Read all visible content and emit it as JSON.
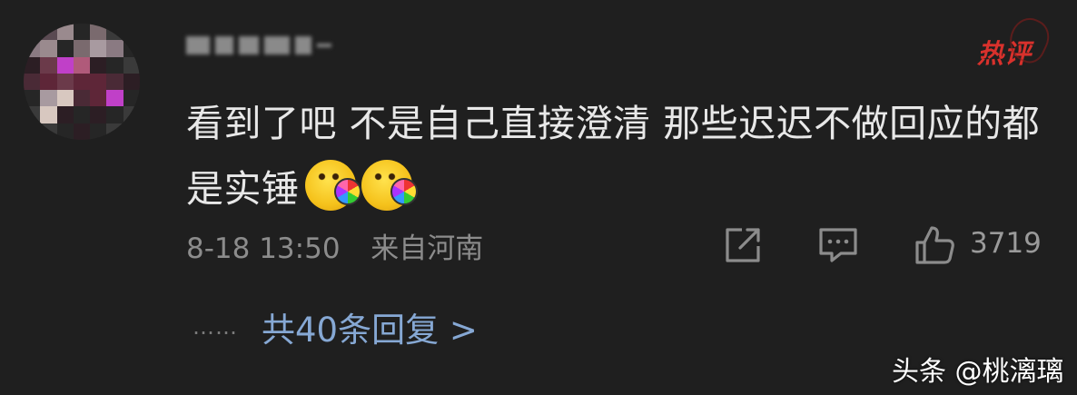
{
  "comment": {
    "hot_badge": "热评",
    "text": "看到了吧 不是自己直接澄清 那些迟迟不做回应的都是实锤",
    "emojis": [
      "tearful-party-emoji",
      "tearful-party-emoji"
    ],
    "timestamp": "8-18 13:50",
    "location": "来自河南",
    "like_count": "3719",
    "replies_dots": "……",
    "replies_label": "共40条回复 >"
  },
  "watermark": "头条 @桃漓璃",
  "colors": {
    "background": "#1f1f1f",
    "text": "#e8e8e8",
    "meta": "#8c8c8c",
    "link": "#86a8d4",
    "hot_badge": "#d8312c"
  },
  "icons": [
    "share-icon",
    "reply-icon",
    "thumbs-up-icon"
  ]
}
